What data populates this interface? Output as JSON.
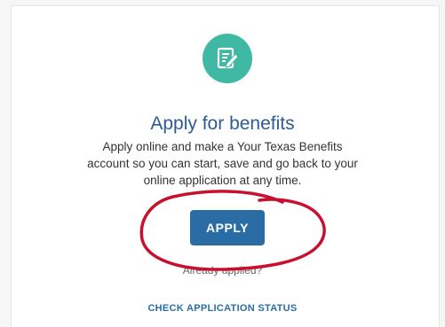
{
  "card": {
    "icon": "edit-document-icon",
    "title": "Apply for benefits",
    "description": "Apply online and make a Your Texas Benefits account so you can start, save and go back to your online application at any time.",
    "apply_button": "APPLY",
    "already_applied": "Already applied?",
    "check_status_link": "CHECK APPLICATION STATUS"
  },
  "colors": {
    "icon_bg": "#3fb8a4",
    "title": "#2c5b92",
    "button_bg": "#2a6da4",
    "annotation_circle": "#c8102e"
  }
}
